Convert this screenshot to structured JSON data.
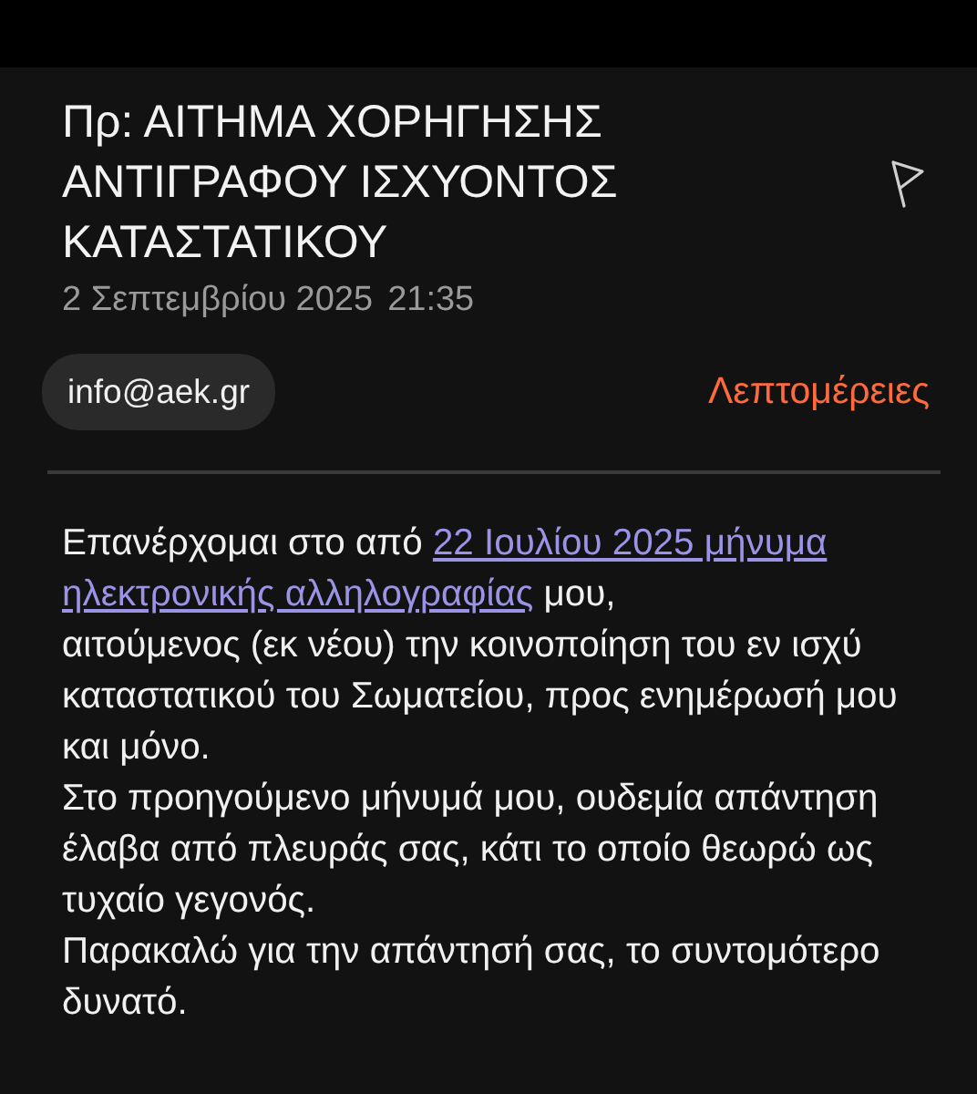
{
  "subject": "Πρ: ΑΙΤΗΜΑ ΧΟΡΗΓΗΣΗΣ ΑΝΤΙΓΡΑΦΟΥ ΙΣΧΥΟΝΤΟΣ ΚΑΤΑΣΤΑΤΙΚΟΥ",
  "date": "2 Σεπτεμβρίου 2025",
  "time": "21:35",
  "sender": "info@aek.gr",
  "details_link": "Λεπτομέρειες",
  "body": [
    [
      {
        "kind": "text",
        "text": "Επανέρχομαι στο από "
      },
      {
        "kind": "link",
        "text": "22 Ιουλίου 2025 μήνυμα"
      }
    ],
    [
      {
        "kind": "link",
        "text": "ηλεκτρονικής αλληλογραφίας"
      },
      {
        "kind": "text",
        "text": " μου,"
      }
    ],
    [
      {
        "kind": "text",
        "text": "αιτούμενος (εκ νέου) την κοινοποίηση του εν ισχύ καταστατικού του Σωματείου, προς ενημέρωσή μου και μόνο."
      }
    ],
    [
      {
        "kind": "text",
        "text": "Στο προηγούμενο μήνυμά μου, ουδεμία απάντηση έλαβα από πλευράς σας, κάτι το οποίο θεωρώ ως τυχαίο γεγονός."
      }
    ],
    [
      {
        "kind": "text",
        "text": "Παρακαλώ για την απάντησή σας, το συντομότερο δυνατό."
      }
    ]
  ]
}
